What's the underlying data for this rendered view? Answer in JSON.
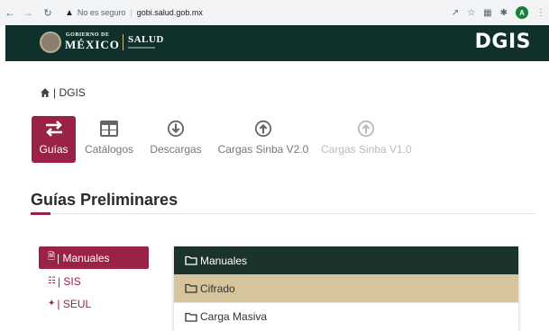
{
  "browser": {
    "back_icon": "arrow-left-icon",
    "forward_icon": "arrow-right-icon",
    "reload_icon": "reload-icon",
    "warning_icon": "warning-triangle-icon",
    "security_label": "No es seguro",
    "url": "gobi.salud.gob.mx",
    "profile_initial": "A"
  },
  "header": {
    "gob_top": "GOBIERNO DE",
    "gob_main": "MÉXICO",
    "department": "SALUD",
    "site_logo": "DGIS",
    "bg_color": "#10312b"
  },
  "breadcrumb": {
    "home_icon": "home-icon",
    "label": "| DGIS"
  },
  "tabs": [
    {
      "label": "Guías",
      "icon": "swap-arrows-icon",
      "active": true
    },
    {
      "label": "Catálogos",
      "icon": "table-icon",
      "active": false
    },
    {
      "label": "Descargas",
      "icon": "download-circle-icon",
      "active": false
    },
    {
      "label": "Cargas Sinba V2.0",
      "icon": "upload-circle-icon",
      "active": false
    },
    {
      "label": "Cargas Sinba V1.0",
      "icon": "upload-circle-icon",
      "active": false,
      "disabled": true
    }
  ],
  "section": {
    "title": "Guías Preliminares"
  },
  "sidebar": {
    "items": [
      {
        "label": "| Manuales",
        "icon": "file-icon",
        "active": true
      },
      {
        "label": "| SIS",
        "icon": "sitemap-icon",
        "active": false
      },
      {
        "label": "| SEUL",
        "icon": "network-icon",
        "active": false
      }
    ]
  },
  "panel": {
    "rows": [
      {
        "label": "Manuales",
        "icon": "folder-icon",
        "state": "header"
      },
      {
        "label": "Cifrado",
        "icon": "folder-icon",
        "state": "selected"
      },
      {
        "label": "Carga Masiva",
        "icon": "folder-icon",
        "state": "normal"
      }
    ]
  },
  "colors": {
    "accent": "#9b2247",
    "header_green": "#10312b",
    "selected_row": "#d6c59c"
  }
}
